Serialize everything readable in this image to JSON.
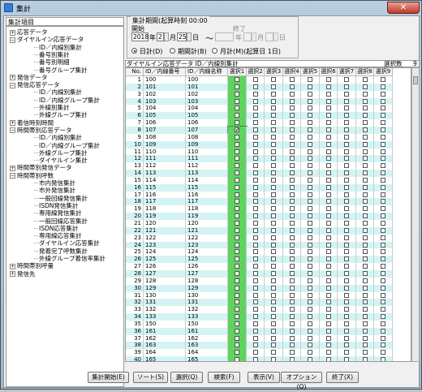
{
  "window": {
    "title": "集計",
    "close": "✕"
  },
  "tree": {
    "header": "集計項目",
    "nodes": [
      {
        "label": "応答データ",
        "level": 0,
        "box": "+"
      },
      {
        "label": "ダイヤルイン応答データ",
        "level": 0,
        "box": "−"
      },
      {
        "label": "ID／内線別集計",
        "level": 2,
        "box": ""
      },
      {
        "label": "番号別集計",
        "level": 2,
        "box": ""
      },
      {
        "label": "番号別明細",
        "level": 2,
        "box": ""
      },
      {
        "label": "番号グループ集計",
        "level": 2,
        "box": ""
      },
      {
        "label": "発信データ",
        "level": 0,
        "box": "+"
      },
      {
        "label": "発信応答データ",
        "level": 0,
        "box": "−"
      },
      {
        "label": "ID／内線別集計",
        "level": 2,
        "box": ""
      },
      {
        "label": "ID／内線グループ集計",
        "level": 2,
        "box": ""
      },
      {
        "label": "外線別集計",
        "level": 2,
        "box": ""
      },
      {
        "label": "外線グループ集計",
        "level": 2,
        "box": ""
      },
      {
        "label": "着信時刻時間",
        "level": 0,
        "box": "+"
      },
      {
        "label": "時間帯別応答データ",
        "level": 0,
        "box": "−"
      },
      {
        "label": "ID／内線別集計",
        "level": 2,
        "box": ""
      },
      {
        "label": "ID／内線グループ集計",
        "level": 2,
        "box": ""
      },
      {
        "label": "外線グループ集計",
        "level": 2,
        "box": ""
      },
      {
        "label": "ダイヤルイン集計",
        "level": 2,
        "box": ""
      },
      {
        "label": "時間帯別発信データ",
        "level": 0,
        "box": "+"
      },
      {
        "label": "時間帯別呼数",
        "level": 0,
        "box": "−"
      },
      {
        "label": "市内発信集計",
        "level": 2,
        "box": ""
      },
      {
        "label": "市外発信集計",
        "level": 2,
        "box": ""
      },
      {
        "label": "一般回線発信集計",
        "level": 2,
        "box": ""
      },
      {
        "label": "ISDN発信集計",
        "level": 2,
        "box": ""
      },
      {
        "label": "専用線発信集計",
        "level": 2,
        "box": ""
      },
      {
        "label": "一般回線応答集計",
        "level": 2,
        "box": ""
      },
      {
        "label": "ISDN応答集計",
        "level": 2,
        "box": ""
      },
      {
        "label": "専用線応答集計",
        "level": 2,
        "box": ""
      },
      {
        "label": "ダイヤルイン応答集計",
        "level": 2,
        "box": ""
      },
      {
        "label": "発着完了呼数集計",
        "level": 2,
        "box": ""
      },
      {
        "label": "外線グループ着信率集計",
        "level": 2,
        "box": ""
      },
      {
        "label": "時間帯別呼量",
        "level": 0,
        "box": "+"
      },
      {
        "label": "発信先",
        "level": 0,
        "box": "+"
      }
    ]
  },
  "period": {
    "legend": "集計期間(起算時刻 00:00",
    "start_label": "開始",
    "end_label": "終了",
    "start_year": "2018",
    "start_month": "2",
    "start_day": "25",
    "unit_year": "年",
    "unit_month": "月",
    "unit_day": "日",
    "tilde": "～",
    "radios": [
      {
        "label": "日計(D)",
        "selected": true
      },
      {
        "label": "期間計(B)",
        "selected": false
      },
      {
        "label": "月計(M)(起算日 1日)",
        "selected": false
      }
    ]
  },
  "grid": {
    "title": "ダイヤルイン応答データ ID／内線別集計",
    "select_count_label": "選択数",
    "select_count": "9",
    "headers": [
      "No.",
      "ID／内線番号",
      "ID／内線名称",
      "選択1",
      "選択2",
      "選択3",
      "選択4",
      "選択5",
      "選択6",
      "選択7",
      "選択8",
      "選択9"
    ],
    "rows": [
      {
        "no": "1",
        "id": "100",
        "name": "100"
      },
      {
        "no": "2",
        "id": "101",
        "name": "101"
      },
      {
        "no": "3",
        "id": "102",
        "name": "102"
      },
      {
        "no": "4",
        "id": "103",
        "name": "103"
      },
      {
        "no": "5",
        "id": "104",
        "name": "104"
      },
      {
        "no": "6",
        "id": "105",
        "name": "105"
      },
      {
        "no": "7",
        "id": "106",
        "name": "106"
      },
      {
        "no": "8",
        "id": "107",
        "name": "107"
      },
      {
        "no": "9",
        "id": "108",
        "name": "108"
      },
      {
        "no": "10",
        "id": "109",
        "name": "109"
      },
      {
        "no": "11",
        "id": "110",
        "name": "110"
      },
      {
        "no": "12",
        "id": "111",
        "name": "111"
      },
      {
        "no": "13",
        "id": "112",
        "name": "112"
      },
      {
        "no": "14",
        "id": "113",
        "name": "113"
      },
      {
        "no": "15",
        "id": "114",
        "name": "114"
      },
      {
        "no": "16",
        "id": "115",
        "name": "115"
      },
      {
        "no": "17",
        "id": "116",
        "name": "116"
      },
      {
        "no": "18",
        "id": "117",
        "name": "117"
      },
      {
        "no": "19",
        "id": "118",
        "name": "118"
      },
      {
        "no": "20",
        "id": "119",
        "name": "119"
      },
      {
        "no": "21",
        "id": "120",
        "name": "120"
      },
      {
        "no": "22",
        "id": "121",
        "name": "121"
      },
      {
        "no": "23",
        "id": "122",
        "name": "122"
      },
      {
        "no": "24",
        "id": "123",
        "name": "123"
      },
      {
        "no": "25",
        "id": "124",
        "name": "124"
      },
      {
        "no": "26",
        "id": "125",
        "name": "125"
      },
      {
        "no": "27",
        "id": "126",
        "name": "126"
      },
      {
        "no": "28",
        "id": "127",
        "name": "127"
      },
      {
        "no": "29",
        "id": "128",
        "name": "128"
      },
      {
        "no": "30",
        "id": "129",
        "name": "129"
      },
      {
        "no": "31",
        "id": "130",
        "name": "130"
      },
      {
        "no": "32",
        "id": "131",
        "name": "131"
      },
      {
        "no": "33",
        "id": "132",
        "name": "132"
      },
      {
        "no": "34",
        "id": "133",
        "name": "133"
      },
      {
        "no": "35",
        "id": "150",
        "name": "150"
      },
      {
        "no": "36",
        "id": "161",
        "name": "161"
      },
      {
        "no": "37",
        "id": "162",
        "name": "162"
      },
      {
        "no": "38",
        "id": "163",
        "name": "163"
      },
      {
        "no": "39",
        "id": "164",
        "name": "164"
      },
      {
        "no": "40",
        "id": "165",
        "name": "165"
      }
    ],
    "checked_row_index": 7,
    "checked_col": 1,
    "colors": {
      "stripe": "#d4f4f4",
      "green": "#5fd35f",
      "white": "#ffffff"
    }
  },
  "buttons": [
    {
      "label": "集計開始(E)",
      "name": "start-button"
    },
    {
      "label": "ソート(S)",
      "name": "sort-button"
    },
    {
      "label": "選択(Q)",
      "name": "select-button"
    },
    {
      "label": "検索(F)",
      "name": "search-button"
    },
    {
      "label": "表示(V)",
      "name": "view-button"
    },
    {
      "label": "オプション(O)",
      "name": "options-button"
    },
    {
      "label": "終了(X)",
      "name": "exit-button"
    }
  ]
}
